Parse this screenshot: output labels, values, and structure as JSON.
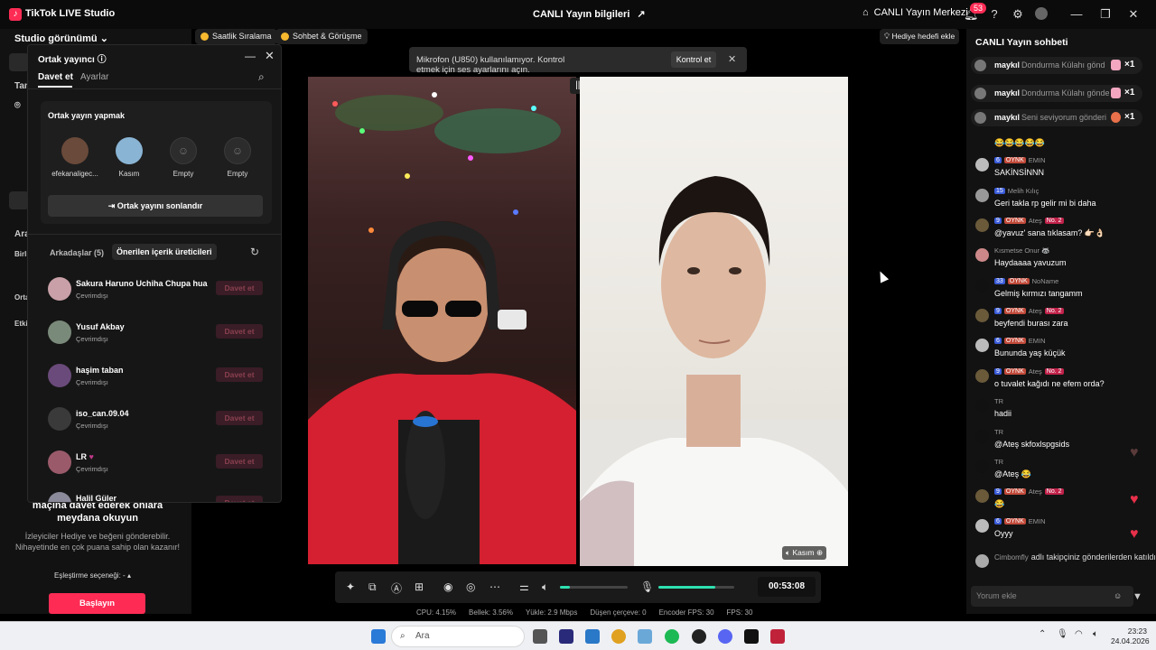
{
  "titlebar": {
    "app_name": "TikTok LIVE Studio",
    "center_title": "CANLI Yayın bilgileri",
    "center_icon": "share-icon",
    "live_center": "CANLI Yayın Merkezi",
    "notification_count": "53"
  },
  "left": {
    "studio_view": "Studio görünümü",
    "frag_tam": "Tam",
    "frag_ara": "Ara",
    "frag_birli": "Birli",
    "frag_orta": "Orta",
    "frag_etki": "Etki",
    "invite_text": "maçına davet ederek onlara meydana okuyun",
    "invite_sub": "İzleyiciler Hediye ve beğeni gönderebilir. Nihayetinde en çok puana sahip olan kazanır!",
    "match_option": "Eşleştirme seçeneği: -",
    "start_button": "Başlayın"
  },
  "tags": {
    "hourly": "Saatlik Sıralama",
    "chat_meet": "Sohbet & Görüşme",
    "gift_goal": "Hediye hedefi ekle"
  },
  "guest_panel": {
    "title": "Ortak yayıncı",
    "tab_invite": "Davet et",
    "tab_settings": "Ayarlar",
    "card_title": "Ortak yayın yapmak",
    "slots": [
      {
        "name": "efekanaligec..."
      },
      {
        "name": "Kasım"
      },
      {
        "name": "Empty"
      },
      {
        "name": "Empty"
      }
    ],
    "end_button": "Ortak yayını sonlandır",
    "friends_tab": "Arkadaşlar (5)",
    "suggested_tab": "Önerilen içerik üreticileri",
    "friends": [
      {
        "name": "Sakura Haruno Uchiha Chupa hua",
        "status": "Çevrimdışı",
        "action": "Davet et"
      },
      {
        "name": "Yusuf Akbay",
        "status": "Çevrimdışı",
        "action": "Davet et"
      },
      {
        "name": "haşim taban",
        "status": "Çevrimdışı",
        "action": "Davet et"
      },
      {
        "name": "iso_can.09.04",
        "status": "Çevrimdışı",
        "action": "Davet et"
      },
      {
        "name": "LR",
        "status": "Çevrimdışı",
        "action": "Davet et"
      },
      {
        "name": "Halil Güler",
        "status": "",
        "action": "Davet et"
      }
    ]
  },
  "notification": {
    "message": "Mikrofon (U850) kullanılamıyor. Kontrol etmek için ses ayarlarını açın.",
    "button": "Kontrol et"
  },
  "video": {
    "guest_label": "Kasım"
  },
  "controls": {
    "timer": "00:53:08",
    "speaker_volume": 0.15,
    "mic_volume": 0.75
  },
  "stats": {
    "cpu": "CPU: 4.15%",
    "memory": "Bellek: 3.56%",
    "upload": "Yükle: 2.9 Mbps",
    "dropped": "Düşen çerçeve: 0",
    "encoder_fps": "Encoder FPS: 30",
    "fps": "FPS: 30"
  },
  "chat": {
    "title": "CANLI Yayın sohbeti",
    "gifts": [
      {
        "user": "maykıl",
        "text": "Dondurma Külahı gönd",
        "count": "×1"
      },
      {
        "user": "maykıl",
        "text": "Dondurma Külahı gönde",
        "count": "×1"
      },
      {
        "user": "maykıl",
        "text": "Seni seviyorum gönderi",
        "count": "×1"
      }
    ],
    "emoji_row": "😂😂😂😂😂",
    "messages": [
      {
        "level": "6",
        "fan": "OYNK",
        "user": "EMIN",
        "badge": "",
        "text": "SAKİNSİNNN"
      },
      {
        "level": "15",
        "fan": "",
        "user": "Melih Kılıç",
        "badge": "",
        "text": "Geri takla rp gelir mi bi daha"
      },
      {
        "level": "9",
        "fan": "OYNK",
        "user": "Ateş",
        "badge": "No. 2",
        "text": "@yavuz' sana tıklasam? 👉🏻👌🏻"
      },
      {
        "level": "",
        "fan": "",
        "user": "Kısmetse Onur 🦝",
        "badge": "",
        "text": "Haydaaaa yavuzum"
      },
      {
        "level": "33",
        "fan": "OYNK",
        "user": "NoName",
        "badge": "",
        "text": "Gelmiş kırmızı tangamm"
      },
      {
        "level": "9",
        "fan": "OYNK",
        "user": "Ateş",
        "badge": "No. 2",
        "text": "beyfendi burası zara"
      },
      {
        "level": "6",
        "fan": "OYNK",
        "user": "EMIN",
        "badge": "",
        "text": "Bununda yaş küçük"
      },
      {
        "level": "9",
        "fan": "OYNK",
        "user": "Ateş",
        "badge": "No. 2",
        "text": "o tuvalet kağıdı ne efem orda?"
      },
      {
        "level": "",
        "fan": "",
        "user": "TR",
        "badge": "",
        "text": "hadii"
      },
      {
        "level": "",
        "fan": "",
        "user": "TR",
        "badge": "",
        "text": "@Ateş skfoxlspgsids"
      },
      {
        "level": "",
        "fan": "",
        "user": "TR",
        "badge": "",
        "text": "@Ateş 😂"
      },
      {
        "level": "9",
        "fan": "OYNK",
        "user": "Ateş",
        "badge": "No. 2",
        "text": "😂"
      },
      {
        "level": "6",
        "fan": "OYNK",
        "user": "EMIN",
        "badge": "",
        "text": "Oyyy"
      }
    ],
    "follow_user": "Cimbomfly",
    "follow_text": "adlı takipçiniz gönderilerden katıldı",
    "comment_placeholder": "Yorum ekle"
  },
  "taskbar": {
    "search": "Ara",
    "time": "23:23",
    "date": "24.04.2026"
  }
}
